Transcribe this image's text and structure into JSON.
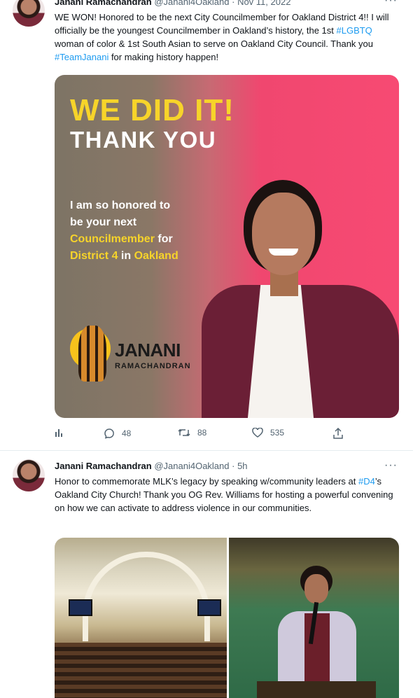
{
  "tweets": [
    {
      "name": "Janani Ramachandran",
      "handle": "@Janani4Oakland",
      "time": "· Nov 11, 2022",
      "more": "···",
      "text_parts": [
        "WE WON! Honored to be the next City Councilmember for Oakland District 4!!  I will officially be the youngest Councilmember in Oakland’s history, the 1st ",
        "#LGBTQ",
        " woman of color & 1st South Asian to serve on Oakland City Council. Thank you ",
        "#TeamJanani",
        " for making history happen!"
      ],
      "image": {
        "headline": "WE DID IT!",
        "subheadline": "THANK YOU",
        "body_line1": "I am so honored to",
        "body_line2": "be your next",
        "body_highlight1": "Councilmember",
        "body_for": " for",
        "body_highlight2": "District 4",
        "body_in": " in ",
        "body_highlight3": "Oakland",
        "logo_name": "JANANI",
        "logo_sub": "RAMACHANDRAN"
      },
      "actions": {
        "views_icon": "analytics-icon",
        "replies": "48",
        "retweets": "88",
        "likes": "535"
      }
    },
    {
      "name": "Janani Ramachandran",
      "handle": "@Janani4Oakland",
      "time": "· 5h",
      "more": "···",
      "text_parts": [
        "Honor to commemorate MLK’s legacy by speaking w/community leaders at ",
        "#D4",
        "’s Oakland City Church! Thank you OG Rev. Williams for hosting a powerful convening on how we can activate to address violence in our communities."
      ]
    }
  ]
}
